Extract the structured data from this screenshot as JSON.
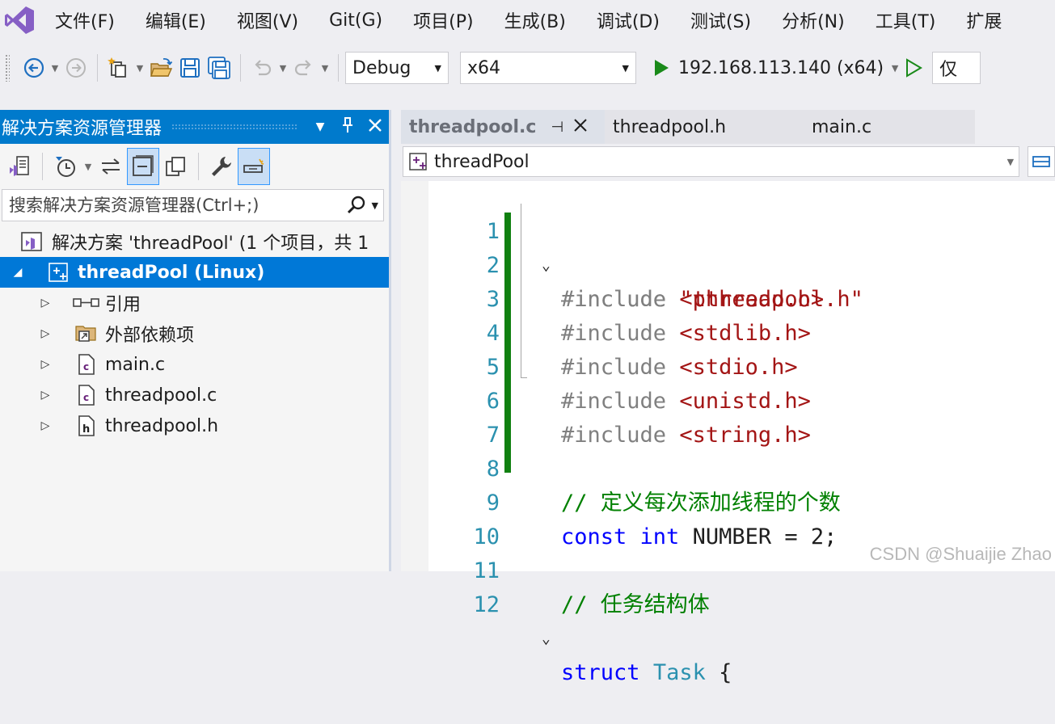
{
  "menubar": {
    "items": [
      "文件(F)",
      "编辑(E)",
      "视图(V)",
      "Git(G)",
      "项目(P)",
      "生成(B)",
      "调试(D)",
      "测试(S)",
      "分析(N)",
      "工具(T)",
      "扩展"
    ]
  },
  "toolbar": {
    "configuration": "Debug",
    "platform": "x64",
    "run_target": "192.168.113.140 (x64)",
    "trailing_label": "仅"
  },
  "solution_explorer": {
    "title": "解决方案资源管理器",
    "search_placeholder": "搜索解决方案资源管理器(Ctrl+;)",
    "solution_label": "解决方案 'threadPool' (1 个项目，共 1",
    "project_label": "threadPool (Linux)",
    "nodes": [
      {
        "label": "引用",
        "icon": "references-icon"
      },
      {
        "label": "外部依赖项",
        "icon": "external-dependencies-icon"
      },
      {
        "label": "main.c",
        "icon": "c-file-icon"
      },
      {
        "label": "threadpool.c",
        "icon": "c-file-icon"
      },
      {
        "label": "threadpool.h",
        "icon": "h-file-icon"
      }
    ]
  },
  "editor": {
    "tabs": [
      {
        "label": "threadpool.c",
        "active": true
      },
      {
        "label": "threadpool.h",
        "active": false
      },
      {
        "label": "main.c",
        "active": false
      }
    ],
    "nav_scope": "threadPool",
    "line_numbers": [
      "1",
      "2",
      "3",
      "4",
      "5",
      "6",
      "7",
      "8",
      "9",
      "10",
      "11",
      "12"
    ],
    "code": {
      "include_kw": "#include",
      "l1_str": "\"threadpool.h\"",
      "l2_str": "<pthread.h>",
      "l3_str": "<stdlib.h>",
      "l4_str": "<stdio.h>",
      "l5_str": "<unistd.h>",
      "l6_str": "<string.h>",
      "l8_comment": "// 定义每次添加线程的个数",
      "l9_const": "const",
      "l9_int": "int",
      "l9_rest": " NUMBER = 2;",
      "l11_comment": "// 任务结构体",
      "l12_struct": "struct",
      "l12_type": "Task",
      "l12_rest": " {"
    }
  },
  "watermark": "CSDN @Shuaijie Zhao",
  "colors": {
    "accent": "#007acc",
    "selection": "#0078d7",
    "keyword": "#0000ff",
    "string": "#a31515",
    "comment": "#008000",
    "line_number": "#2b91af",
    "change_marker": "#108010"
  }
}
